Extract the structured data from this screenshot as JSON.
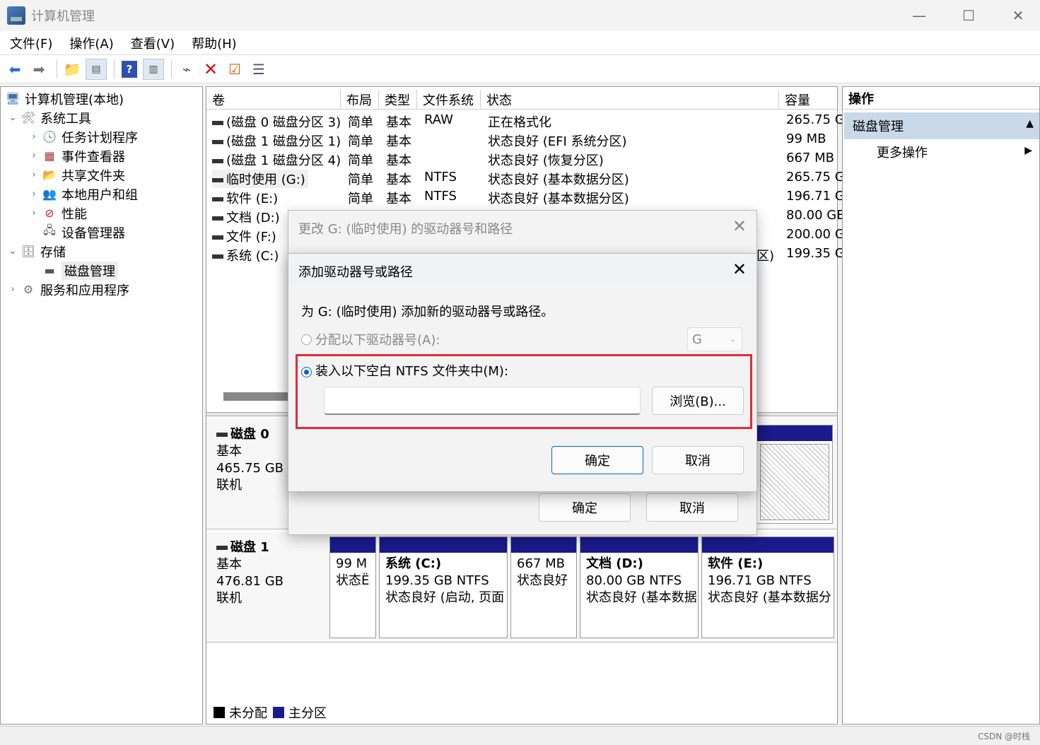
{
  "window": {
    "title": "计算机管理",
    "minimize": "—",
    "maximize": "☐",
    "close": "✕"
  },
  "menu": [
    "文件(F)",
    "操作(A)",
    "查看(V)",
    "帮助(H)"
  ],
  "tree": {
    "root": "计算机管理(本地)",
    "system_tools": "系统工具",
    "task_scheduler": "任务计划程序",
    "event_viewer": "事件查看器",
    "shared_folders": "共享文件夹",
    "local_users": "本地用户和组",
    "performance": "性能",
    "device_manager": "设备管理器",
    "storage": "存储",
    "disk_management": "磁盘管理",
    "services": "服务和应用程序"
  },
  "volume_table": {
    "headers": [
      "卷",
      "布局",
      "类型",
      "文件系统",
      "状态",
      "容量"
    ],
    "rows": [
      {
        "vol": "(磁盘 0 磁盘分区 3)",
        "layout": "简单",
        "type": "基本",
        "fs": "RAW",
        "status": "正在格式化",
        "cap": "265.75 G"
      },
      {
        "vol": "(磁盘 1 磁盘分区 1)",
        "layout": "简单",
        "type": "基本",
        "fs": "",
        "status": "状态良好 (EFI 系统分区)",
        "cap": "99 MB"
      },
      {
        "vol": "(磁盘 1 磁盘分区 4)",
        "layout": "简单",
        "type": "基本",
        "fs": "",
        "status": "状态良好 (恢复分区)",
        "cap": "667 MB"
      },
      {
        "vol": "临时使用 (G:)",
        "layout": "简单",
        "type": "基本",
        "fs": "NTFS",
        "status": "状态良好 (基本数据分区)",
        "cap": "265.75 G"
      },
      {
        "vol": "软件 (E:)",
        "layout": "简单",
        "type": "基本",
        "fs": "NTFS",
        "status": "状态良好 (基本数据分区)",
        "cap": "196.71 G"
      },
      {
        "vol": "文档 (D:)",
        "layout": "",
        "type": "",
        "fs": "",
        "status": "",
        "cap": "80.00 GE"
      },
      {
        "vol": "文件 (F:)",
        "layout": "",
        "type": "",
        "fs": "",
        "status": "",
        "cap": "200.00 G"
      },
      {
        "vol": "系统 (C:)",
        "layout": "",
        "type": "",
        "fs": "",
        "status": "区)",
        "cap": "199.35 G"
      }
    ]
  },
  "disk0": {
    "name": "磁盘 0",
    "type": "基本",
    "size": "465.75 GB",
    "state": "联机"
  },
  "disk1": {
    "name": "磁盘 1",
    "type": "基本",
    "size": "476.81 GB",
    "state": "联机",
    "parts": [
      {
        "title": "",
        "line1": "99 M",
        "line2": "状态Ë"
      },
      {
        "title": "系统 (C:)",
        "line1": "199.35 GB NTFS",
        "line2": "状态良好 (启动, 页面"
      },
      {
        "title": "",
        "line1": "667 MB",
        "line2": "状态良好"
      },
      {
        "title": "文档 (D:)",
        "line1": "80.00 GB NTFS",
        "line2": "状态良好 (基本数据"
      },
      {
        "title": "软件 (E:)",
        "line1": "196.71 GB NTFS",
        "line2": "状态良好 (基本数据分"
      }
    ]
  },
  "legend": {
    "unallocated": "未分配",
    "primary": "主分区"
  },
  "actions": {
    "header": "操作",
    "section": "磁盘管理",
    "more": "更多操作"
  },
  "watermark": "CSDN @时栈",
  "dialog_back": {
    "title": "更改 G: (临时使用) 的驱动器号和路径",
    "ok": "确定",
    "cancel": "取消"
  },
  "dialog_front": {
    "title": "添加驱动器号或路径",
    "description": "为 G: (临时使用) 添加新的驱动器号或路径。",
    "assign_letter_label": "分配以下驱动器号(A):",
    "letter_value": "G",
    "mount_label": "装入以下空白 NTFS 文件夹中(M):",
    "path_value": "",
    "browse": "浏览(B)...",
    "ok": "确定",
    "cancel": "取消"
  },
  "colors": {
    "primary_partition": "#1a1a8c",
    "highlight": "#e32b3a",
    "accent": "#0067c0"
  }
}
